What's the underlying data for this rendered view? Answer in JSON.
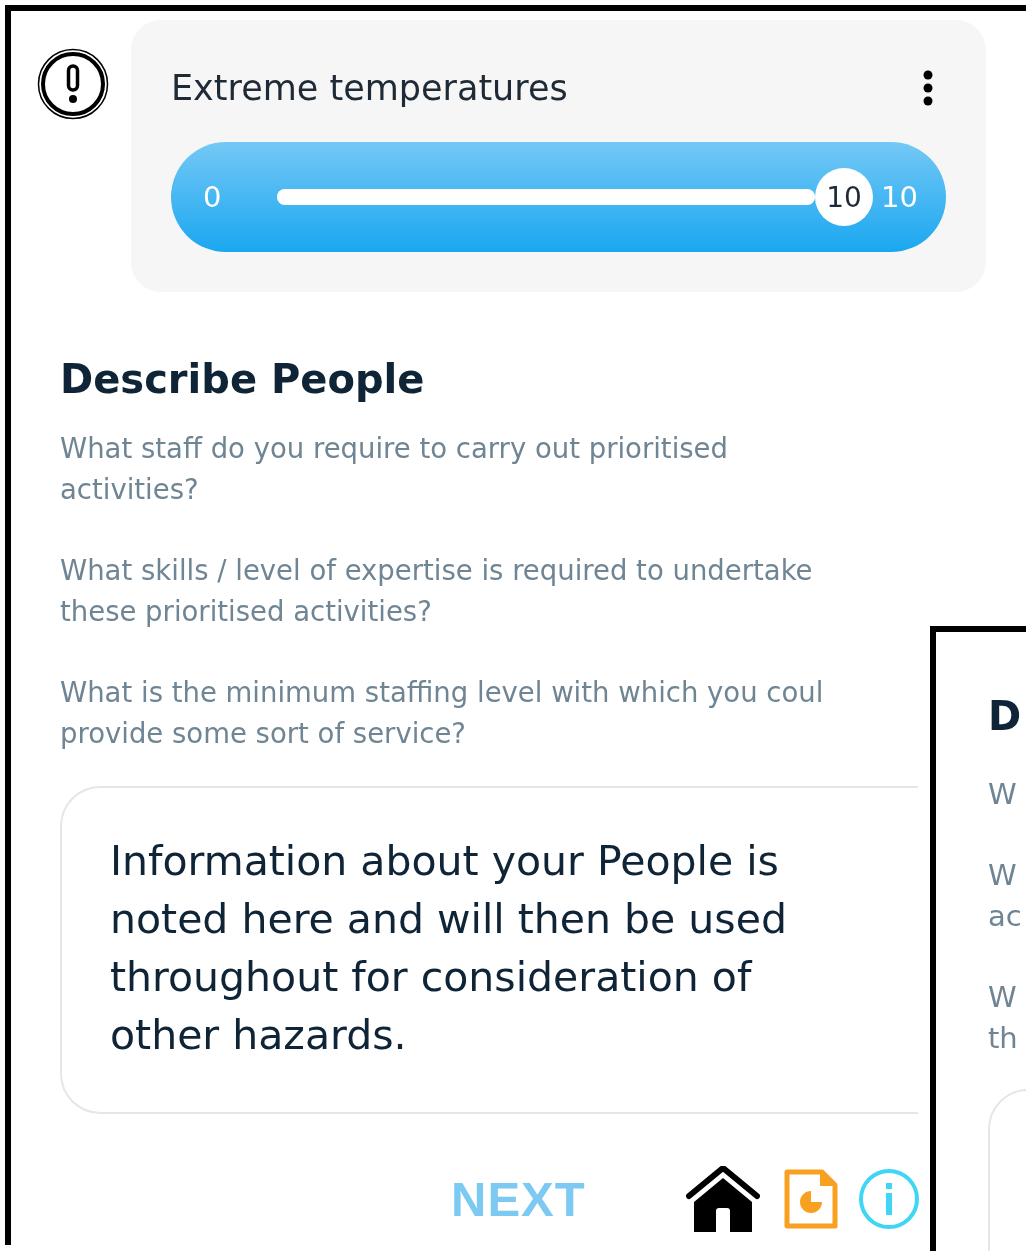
{
  "hazard": {
    "title": "Extreme temperatures",
    "slider": {
      "min_label": "0",
      "value": "10",
      "max_label": "10",
      "level": 1
    }
  },
  "section": {
    "heading": "Describe People",
    "questions": [
      {
        "lines": [
          "What staff do you require to carry out prioritised",
          "activities?"
        ]
      },
      {
        "lines": [
          "What skills / level of expertise is required to undertake",
          "these prioritised activities?"
        ]
      },
      {
        "lines": [
          "What is the minimum staffing level with which you coul",
          "provide some sort of service?"
        ]
      }
    ],
    "note": "Information about your People is noted here and will then be used throughout for consideration of other hazards."
  },
  "nav": {
    "next": "NEXT"
  },
  "overlay_screen": {
    "heading": "D",
    "questions": [
      {
        "lines": [
          "W"
        ]
      },
      {
        "lines": [
          "W",
          "ac"
        ]
      },
      {
        "lines": [
          "W",
          "th"
        ]
      }
    ]
  }
}
